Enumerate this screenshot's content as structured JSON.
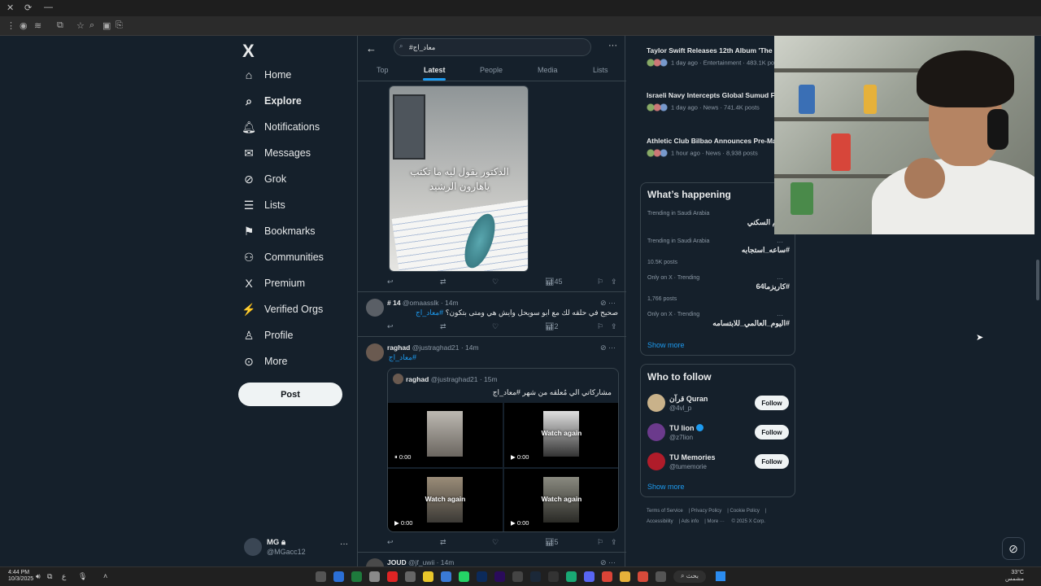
{
  "browser": {
    "title_controls": [
      "✕",
      "⟳",
      "—"
    ],
    "toolbar_icons": [
      "⋮",
      "◉",
      "≋",
      "⧉",
      "☆",
      "⌕",
      "▣",
      "⎘"
    ]
  },
  "nav": {
    "logo": "X",
    "items": [
      {
        "label": "Home",
        "icon": "⌂",
        "icon_name": "home-icon"
      },
      {
        "label": "Explore",
        "icon": "⌕",
        "icon_name": "search-icon"
      },
      {
        "label": "Notifications",
        "icon": "🔔︎",
        "icon_name": "bell-icon"
      },
      {
        "label": "Messages",
        "icon": "✉",
        "icon_name": "mail-icon"
      },
      {
        "label": "Grok",
        "icon": "⊘",
        "icon_name": "grok-icon"
      },
      {
        "label": "Lists",
        "icon": "☰",
        "icon_name": "list-icon"
      },
      {
        "label": "Bookmarks",
        "icon": "⚑",
        "icon_name": "bookmark-icon"
      },
      {
        "label": "Communities",
        "icon": "⚇",
        "icon_name": "people-icon"
      },
      {
        "label": "Premium",
        "icon": "X",
        "icon_name": "x-logo-icon"
      },
      {
        "label": "Verified Orgs",
        "icon": "⚡",
        "icon_name": "lightning-icon"
      },
      {
        "label": "Profile",
        "icon": "♙",
        "icon_name": "person-icon"
      },
      {
        "label": "More",
        "icon": "⊙",
        "icon_name": "more-circle-icon"
      }
    ],
    "post_label": "Post",
    "account": {
      "name": "MG 🔒︎",
      "handle": "@MGacc12",
      "more": "···"
    }
  },
  "search": {
    "back": "←",
    "query": "#معاد_اج",
    "more": "···",
    "tabs": [
      "Top",
      "Latest",
      "People",
      "Media",
      "Lists"
    ]
  },
  "feed": {
    "media1": {
      "caption_line1": "الدكتور يقول ليه ما تكتب",
      "caption_line2": "ياهارون الرشيد"
    },
    "actions1": {
      "reply": "↩",
      "retweet": "⇄",
      "like": "♡",
      "views": "45",
      "bookmark": "⚐",
      "share": "⇪"
    },
    "tweet2": {
      "name": "# 14",
      "meta": "@omaasslk · 14m",
      "text": "صحيح في حلقه لك مع ابو سويحل وايش هي ومتى بتكون؟",
      "tag": "#معاد_اج",
      "views": "2"
    },
    "tweet3": {
      "name": "raghad",
      "meta": "@justraghad21 · 14m",
      "tag": "#معاد_اج",
      "views": "5",
      "quote": {
        "name": "raghad",
        "meta": "@justraghad21 · 15m",
        "text": "مشاركاتي الي مُعلقه من شهر #معاد_اج"
      },
      "videos": [
        {
          "overlay": "",
          "time": "0:00",
          "control": "⏸"
        },
        {
          "overlay": "Watch again",
          "time": "0:00",
          "control": "▶"
        },
        {
          "overlay": "Watch again",
          "time": "0:00",
          "control": "▶"
        },
        {
          "overlay": "Watch again",
          "time": "0:00",
          "control": "▶"
        }
      ]
    },
    "tweet4": {
      "name": "JOUD",
      "meta": "@jf_uwii · 14m"
    }
  },
  "trends_top": [
    {
      "title": "Taylor Swift Releases 12th Album 'The L… of a Showgirl' on October 3",
      "meta": "1 day ago · Entertainment · 483.1K posts"
    },
    {
      "title": "Israeli Navy Intercepts Global Sumud Flotilla, Detains 400 Activists in Gaza A…",
      "meta": "1 day ago · News · 741.4K posts"
    },
    {
      "title": "Athletic Club Bilbao Announces Pre-Ma… Solidarity Ceremony for Palestine at Sa…",
      "meta": "1 hour ago · News · 8,938 posts"
    }
  ],
  "happening": {
    "title": "What’s happening",
    "items": [
      {
        "context": "Trending in Saudi Arabia",
        "title": "الدعم السكني",
        "count": ""
      },
      {
        "context": "Trending in Saudi Arabia",
        "title": "#ساعه_استجابه",
        "count": "10.5K posts"
      },
      {
        "context": "Only on X · Trending",
        "title": "#كاريزما64",
        "count": "1,766 posts"
      },
      {
        "context": "Only on X · Trending",
        "title": "#اليوم_العالمي_للابتسامه",
        "count": ""
      }
    ],
    "show_more": "Show more"
  },
  "who_to_follow": {
    "title": "Who to follow",
    "users": [
      {
        "name": "قرآن Quran",
        "handle": "@4vl_p",
        "follow": "Follow",
        "color": "#c9b28a"
      },
      {
        "name": "TU lion",
        "handle": "@z7lion",
        "follow": "Follow",
        "color": "#6b3a8c"
      },
      {
        "name": "TU Memories",
        "handle": "@tumemorie",
        "follow": "Follow",
        "color": "#b01c2a"
      }
    ],
    "show_more": "Show more"
  },
  "footer": [
    "Terms of Service",
    "Privacy Policy",
    "Cookie Policy",
    "Accessibility",
    "Ads info",
    "More ···",
    "© 2025 X Corp."
  ],
  "taskbar": {
    "time": "4:44 PM",
    "date": "10/3/2025",
    "search": "بحث",
    "weather_temp": "33°C",
    "weather_desc": "مشمس",
    "tray_label": "ع"
  },
  "colors": {
    "accent": "#1d9bf0",
    "background": "#15202b",
    "border": "#38444d"
  }
}
